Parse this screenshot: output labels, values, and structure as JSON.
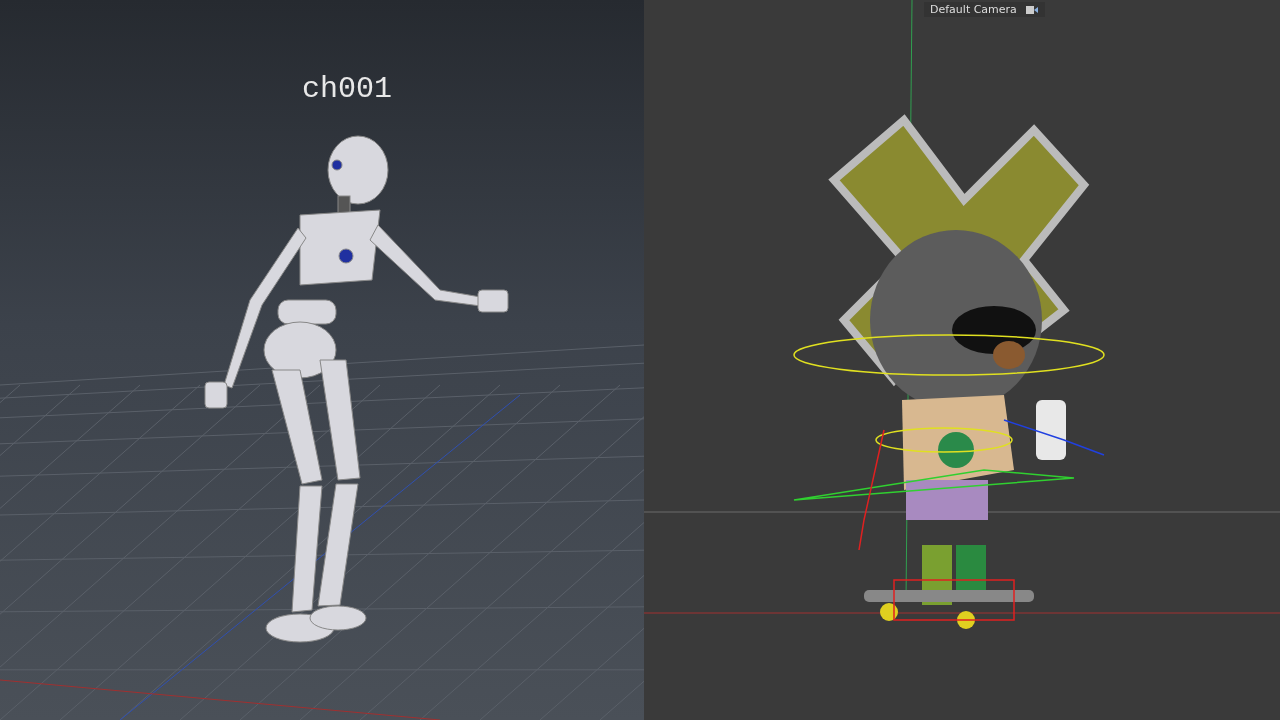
{
  "left_viewport": {
    "character_label": "ch001"
  },
  "right_viewport": {
    "camera_label": "Default Camera"
  }
}
